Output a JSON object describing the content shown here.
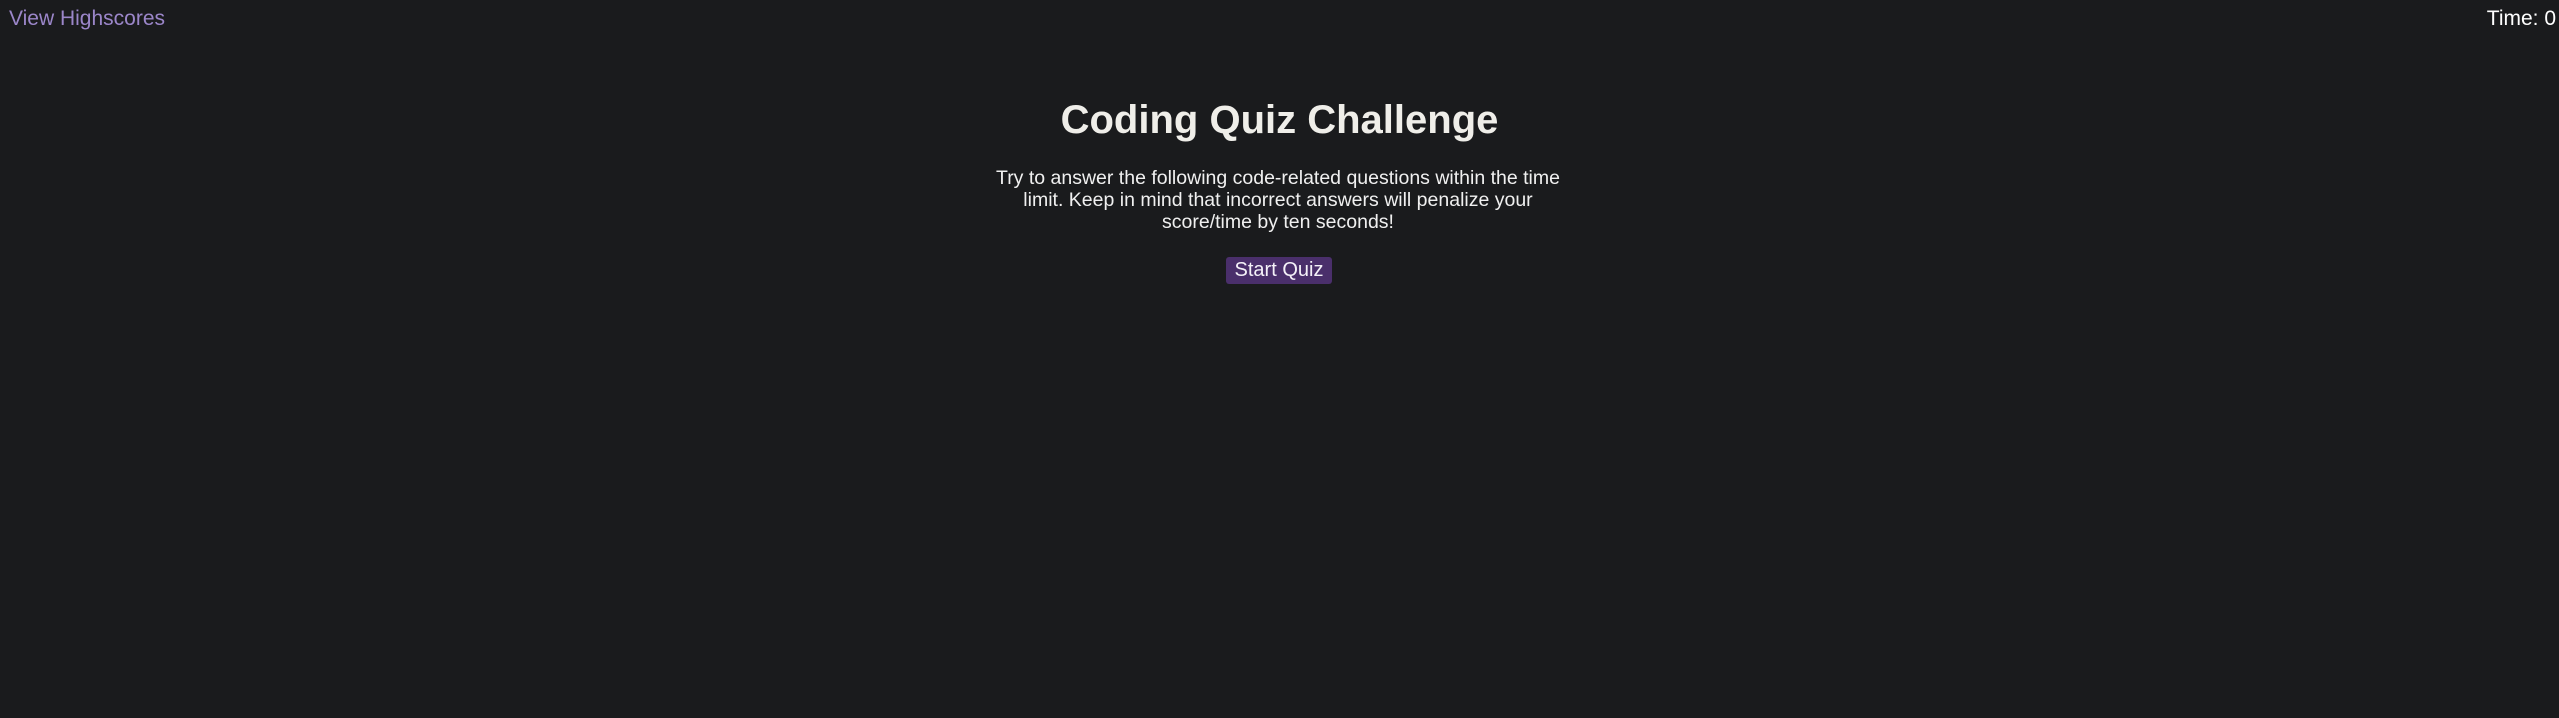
{
  "header": {
    "highscores_link": "View Highscores",
    "timer_label": "Time: 0"
  },
  "main": {
    "title": "Coding Quiz Challenge",
    "intro": "Try to answer the following code-related questions within the time limit. Keep in mind that incorrect answers will penalize your score/time by ten seconds!",
    "start_button": "Start Quiz"
  },
  "colors": {
    "background": "#1a1b1d",
    "link": "#9b86c9",
    "button": "#4a2f6b",
    "text": "#efeee9"
  }
}
